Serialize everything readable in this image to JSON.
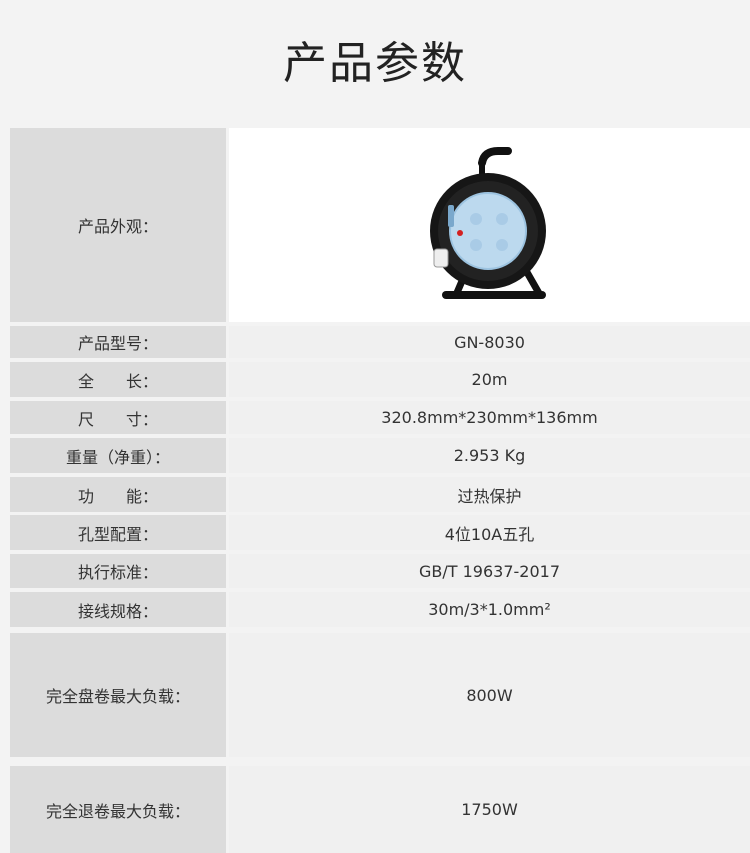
{
  "page": {
    "title": "产品参数"
  },
  "specs": [
    {
      "label": "产品外观：",
      "value": ""
    },
    {
      "label": "产品型号：",
      "value": "GN-8030"
    },
    {
      "label": "全　　长：",
      "value": "20m"
    },
    {
      "label": "尺　　寸：",
      "value": "320.8mm*230mm*136mm"
    },
    {
      "label": "重量（净重）：",
      "value": "2.953 Kg"
    },
    {
      "label": "功　　能：",
      "value": "过热保护"
    },
    {
      "label": "孔型配置：",
      "value": "4位10A五孔"
    },
    {
      "label": "执行标准：",
      "value": "GB/T 19637-2017"
    },
    {
      "label": "接线规格：",
      "value": "30m/3*1.0mm²"
    },
    {
      "label": "完全盘卷最大负载：",
      "value": "800W"
    },
    {
      "label": "完全退卷最大负载：",
      "value": "1750W"
    }
  ],
  "icons": {
    "product_image": "cable-reel-image"
  },
  "colors": {
    "label_bg": "#dcdcdc",
    "value_bg": "#f0f0f0",
    "page_bg": "#f3f3f3",
    "socket_blue": "#bcd9ee"
  }
}
